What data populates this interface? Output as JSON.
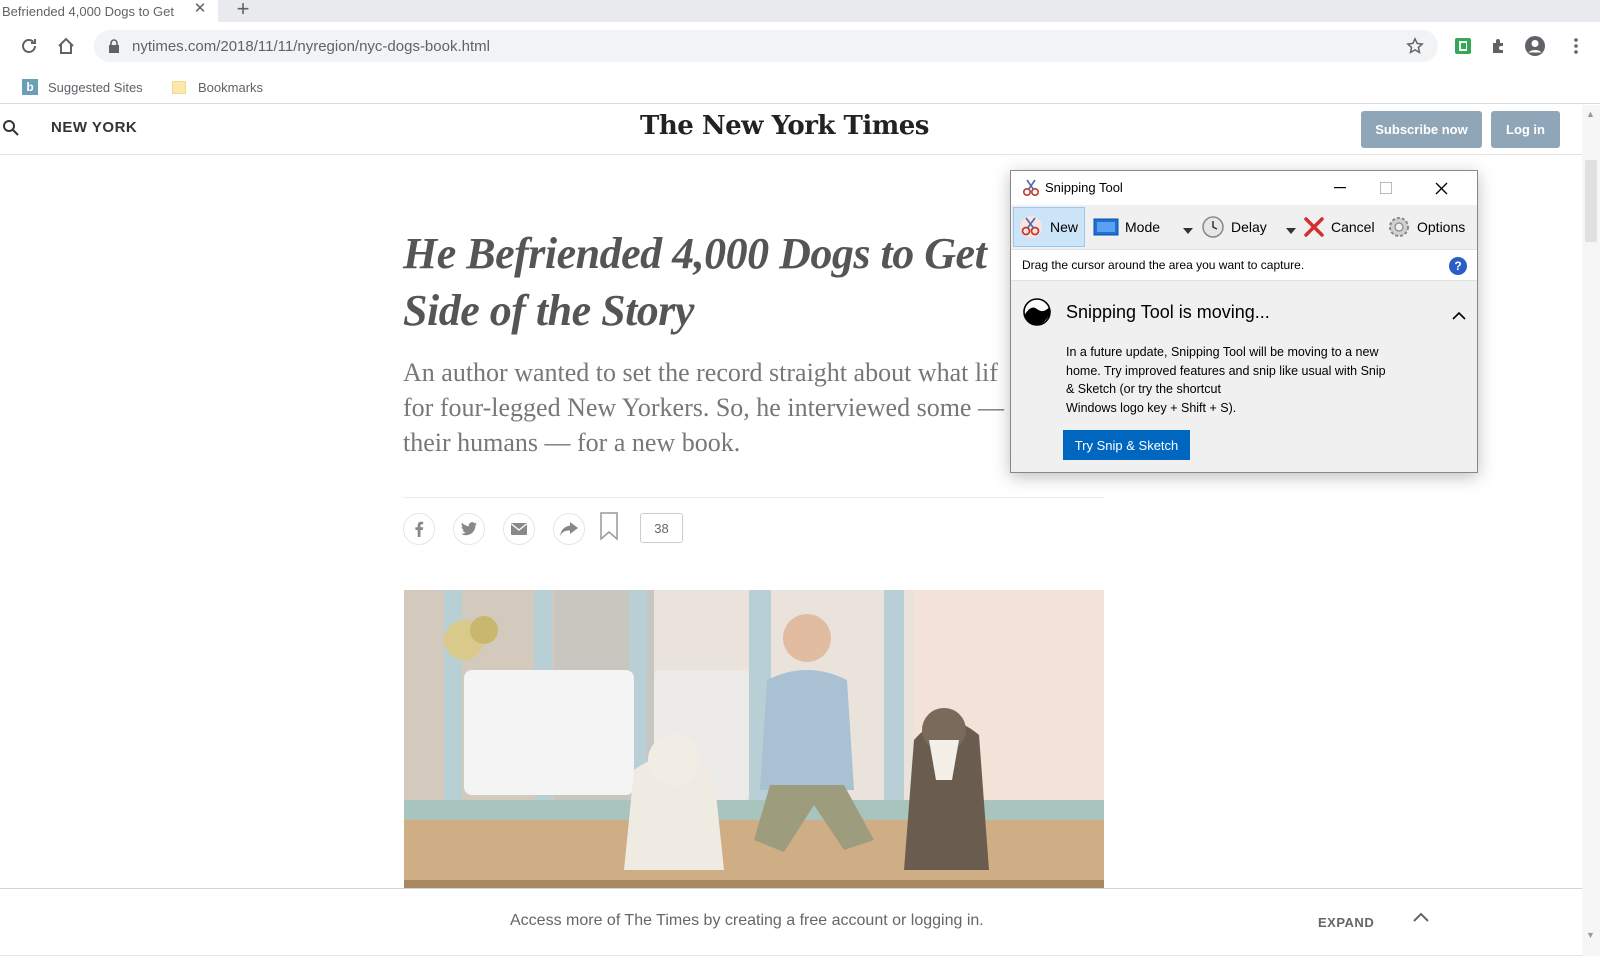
{
  "browser": {
    "tab_title": "Befriended 4,000 Dogs to Get",
    "url_host": "nytimes.com",
    "url_path": "/2018/11/11/nyregion/nyc-dogs-book.html",
    "bookmarks": [
      {
        "label": "Suggested Sites"
      },
      {
        "label": "Bookmarks"
      }
    ]
  },
  "nyt": {
    "section": "NEW YORK",
    "masthead": "The New York Times",
    "subscribe_label": "Subscribe now",
    "login_label": "Log in",
    "headline_line1": "He Befriended 4,000 Dogs to Get",
    "headline_line2": "Side of the Story",
    "summary_line1": "An author wanted to set the record straight about what lif",
    "summary_line2": "for four-legged New Yorkers. So, he interviewed some —",
    "summary_line3": "their humans — for a new book.",
    "comment_count": "38",
    "gateway_text": "Access more of The Times by creating a free account or logging in.",
    "expand_label": "EXPAND"
  },
  "snipping_tool": {
    "title": "Snipping Tool",
    "toolbar": {
      "new_label": "New",
      "mode_label": "Mode",
      "delay_label": "Delay",
      "cancel_label": "Cancel",
      "options_label": "Options"
    },
    "hint": "Drag the cursor around the area you want to capture.",
    "notice_title": "Snipping Tool is moving...",
    "notice_body_1": "In a future update, Snipping Tool will be moving to a new",
    "notice_body_2": "home. Try improved features and snip like usual with Snip",
    "notice_body_3": "& Sketch (or try the shortcut",
    "notice_body_4": "Windows logo key + Shift + S).",
    "try_button": "Try Snip & Sketch"
  },
  "colors": {
    "nyt_button": "#8fa5b8",
    "snip_accent": "#0067c0",
    "cancel_red": "#d32f2f"
  }
}
